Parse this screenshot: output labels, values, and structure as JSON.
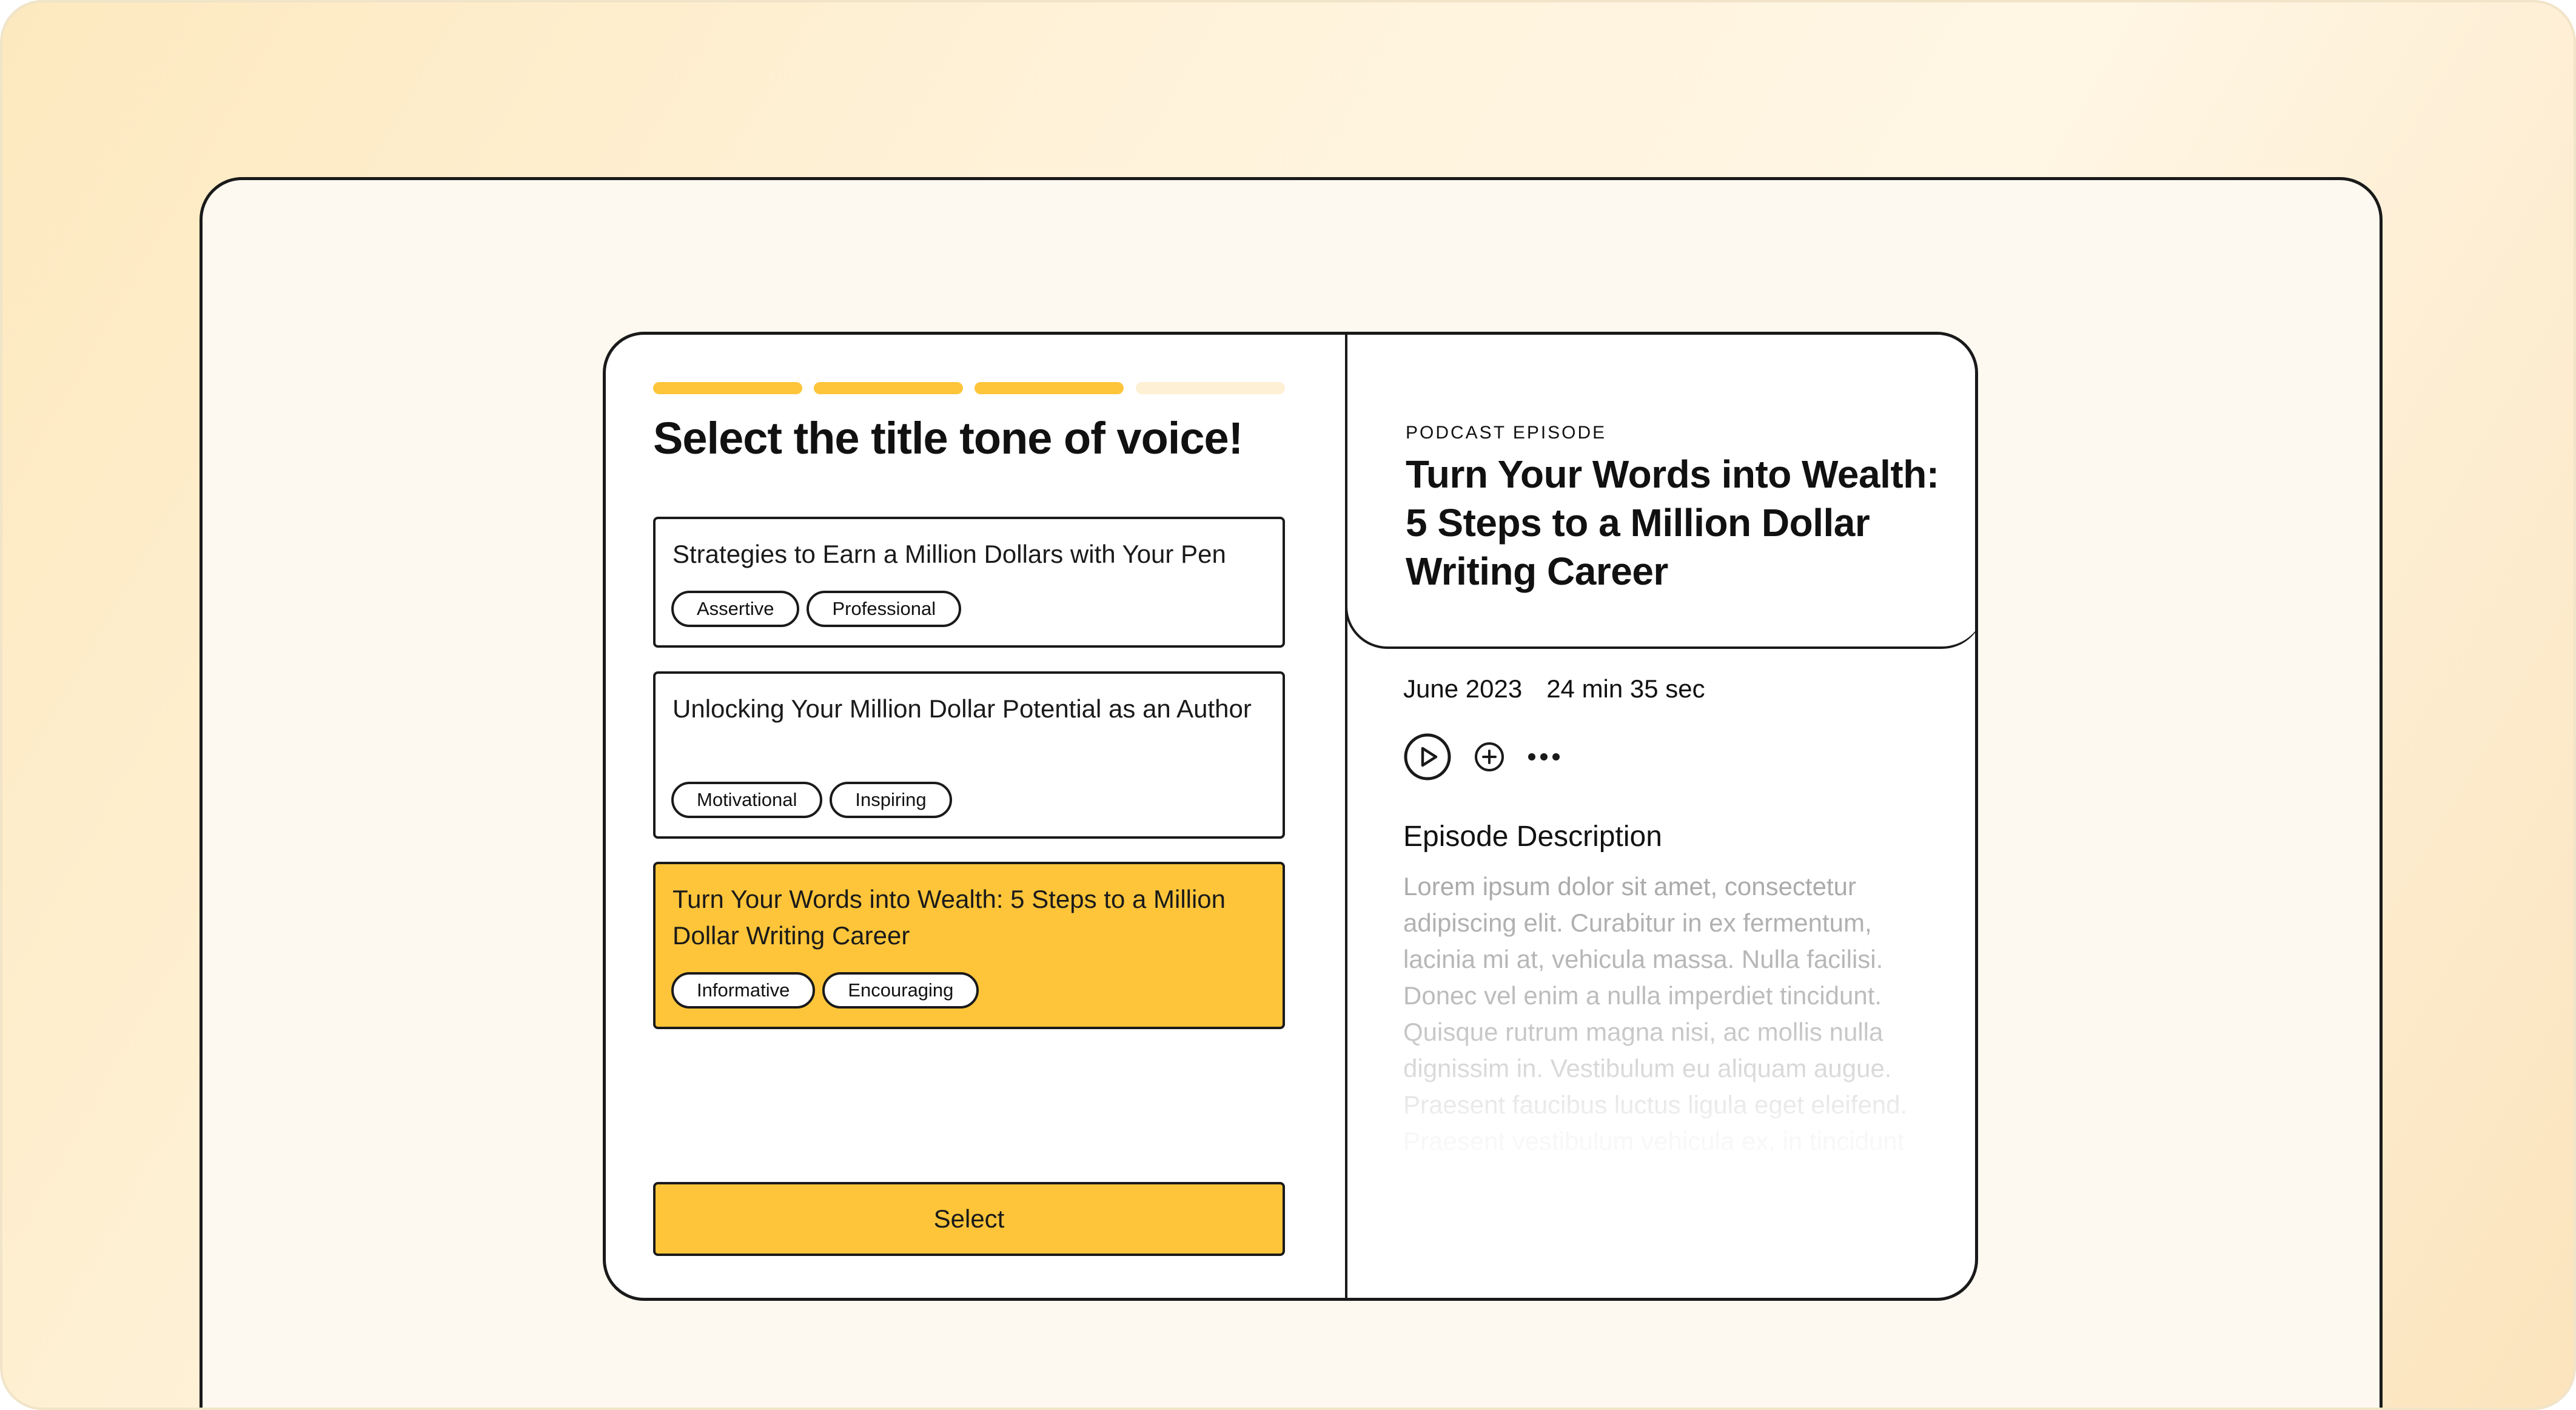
{
  "colors": {
    "accent": "#fec53a",
    "accent_light": "#fdf0d4",
    "border": "#1a1a1a",
    "muted_text": "#8b8b8b"
  },
  "wizard": {
    "progress": {
      "total_steps": 4,
      "completed_steps": 3
    },
    "heading": "Select the title tone of voice!",
    "options": [
      {
        "text": "Strategies to Earn a Million Dollars with Your Pen",
        "tags": [
          "Assertive",
          "Professional"
        ],
        "selected": false
      },
      {
        "text": "Unlocking Your Million Dollar Potential as an Author",
        "tags": [
          "Motivational",
          "Inspiring"
        ],
        "selected": false
      },
      {
        "text": "Turn Your Words into Wealth: 5 Steps to a Million Dollar Writing Career",
        "tags": [
          "Informative",
          "Encouraging"
        ],
        "selected": true
      }
    ],
    "select_label": "Select"
  },
  "episode": {
    "kicker": "PODCAST EPISODE",
    "title": "Turn Your Words into Wealth: 5 Steps to a Million Dollar Writing Career",
    "date": "June 2023",
    "duration": "24 min 35 sec",
    "icons": {
      "play": "play-circle-icon",
      "add": "plus-circle-icon",
      "more": "more-horizontal-icon"
    },
    "description_title": "Episode Description",
    "description": "Lorem ipsum dolor sit amet, consectetur adipiscing elit. Curabitur in ex fermentum, lacinia mi at, vehicula massa. Nulla facilisi. Donec vel enim a nulla imperdiet tincidunt. Quisque rutrum magna nisi, ac mollis nulla dignissim in. Vestibulum eu aliquam augue. Praesent faucibus luctus ligula eget eleifend. Praesent vestibulum vehicula ex, in tincidunt"
  }
}
